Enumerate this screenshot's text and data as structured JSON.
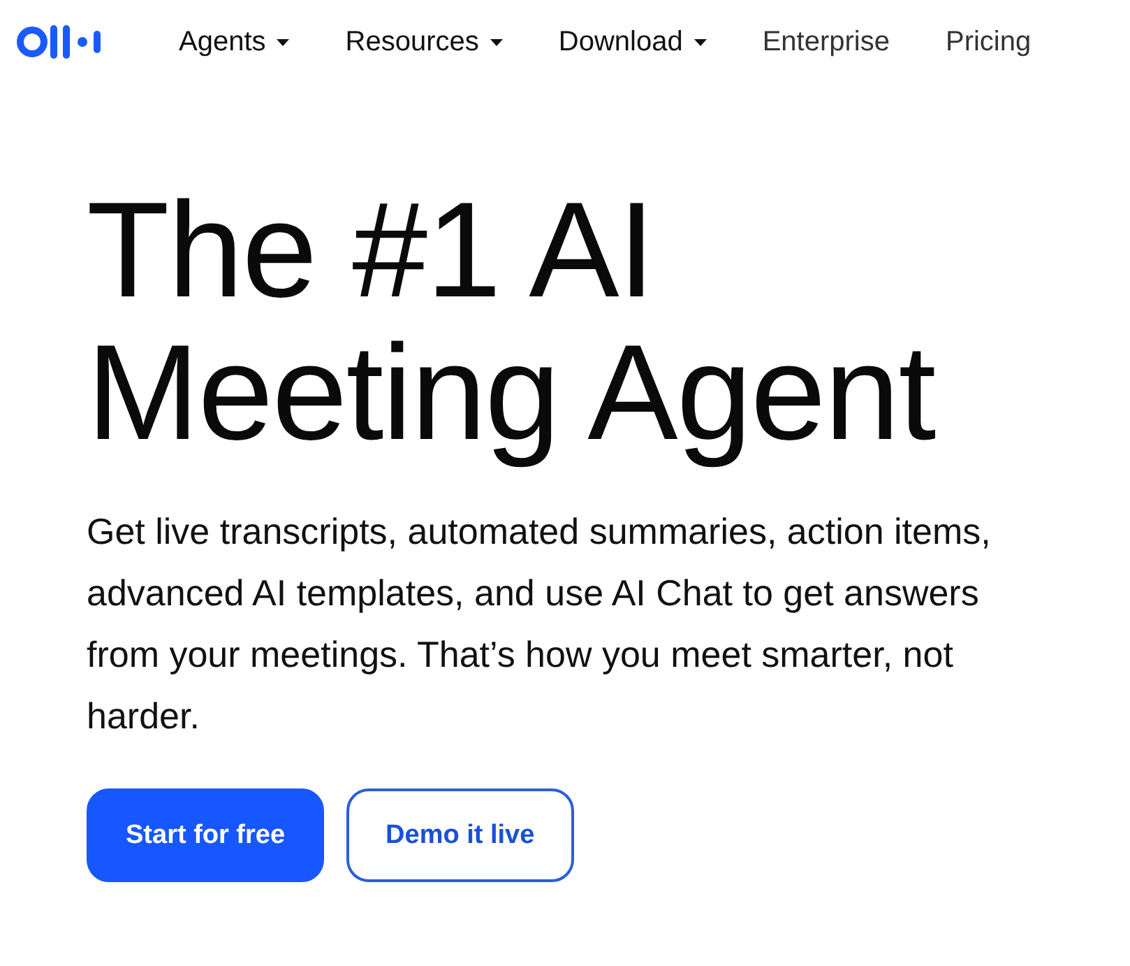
{
  "nav": {
    "items": [
      {
        "label": "Agents",
        "has_menu": true
      },
      {
        "label": "Resources",
        "has_menu": true
      },
      {
        "label": "Download",
        "has_menu": true
      },
      {
        "label": "Enterprise",
        "has_menu": false
      },
      {
        "label": "Pricing",
        "has_menu": false
      }
    ]
  },
  "hero": {
    "title_lines": [
      "The #1 AI",
      "Meeting Agent"
    ],
    "description": "Get live transcripts, automated summaries, action items, advanced AI templates, and use AI Chat to get answers from your meetings. That’s how you meet smarter, not harder.",
    "buttons": [
      {
        "label": "Start for free",
        "kind": "primary"
      },
      {
        "label": "Demo it live",
        "kind": "outline"
      }
    ]
  }
}
